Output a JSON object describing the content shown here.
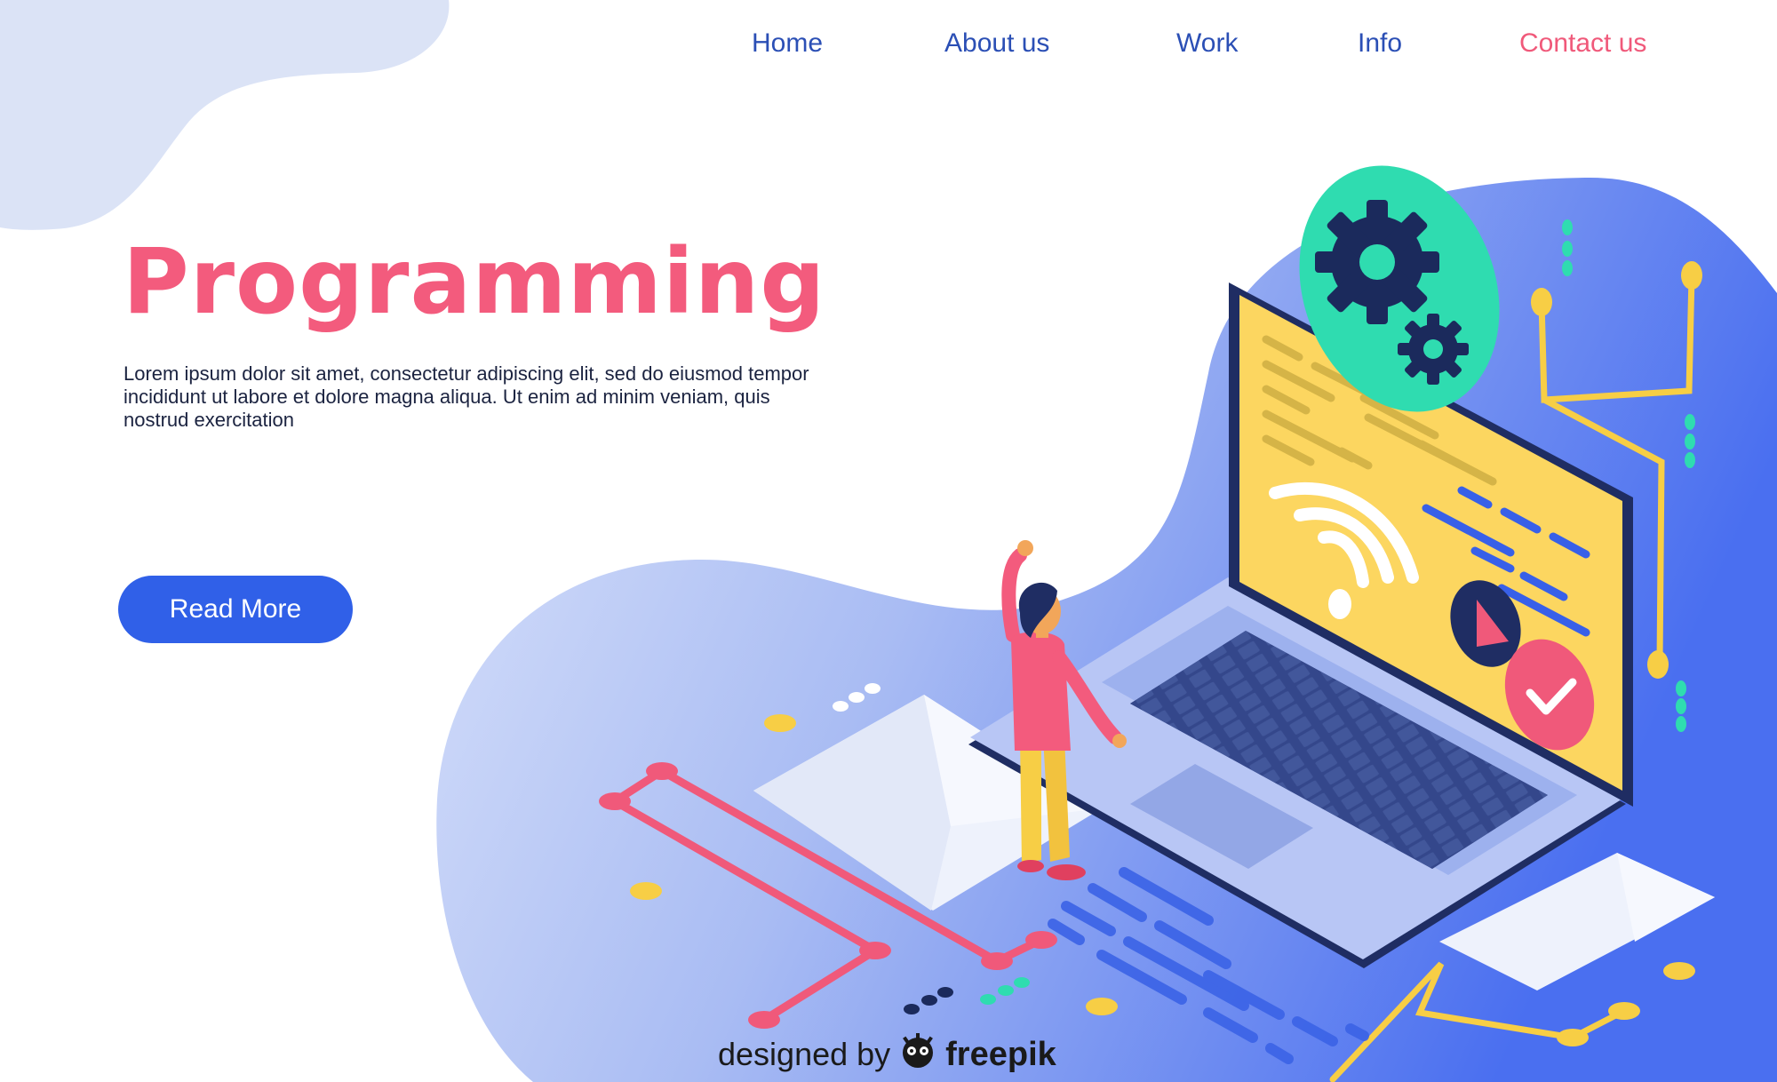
{
  "nav": {
    "items": [
      {
        "label": "Home"
      },
      {
        "label": "About us"
      },
      {
        "label": "Work"
      },
      {
        "label": "Info"
      },
      {
        "label": "Contact us"
      }
    ]
  },
  "hero": {
    "title": "Programming",
    "description": "Lorem ipsum dolor sit amet, consectetur adipiscing elit, sed do eiusmod tempor incididunt ut labore et dolore magna aliqua. Ut enim ad minim veniam, quis nostrud exercitation",
    "cta_label": "Read More"
  },
  "footer": {
    "credit_text": "designed by",
    "brand": "freepik"
  },
  "colors": {
    "accent_pink": "#f35b7d",
    "nav_blue": "#2b4fb5",
    "button_blue": "#3060e8",
    "screen_yellow": "#fcd660",
    "gear_green": "#2fdcb0"
  },
  "icons": {
    "gears": "gear-icon",
    "wifi": "wifi-icon",
    "play": "play-icon",
    "check": "check-icon",
    "mail": "envelope-icon",
    "logo": "freepik-logo-icon"
  }
}
